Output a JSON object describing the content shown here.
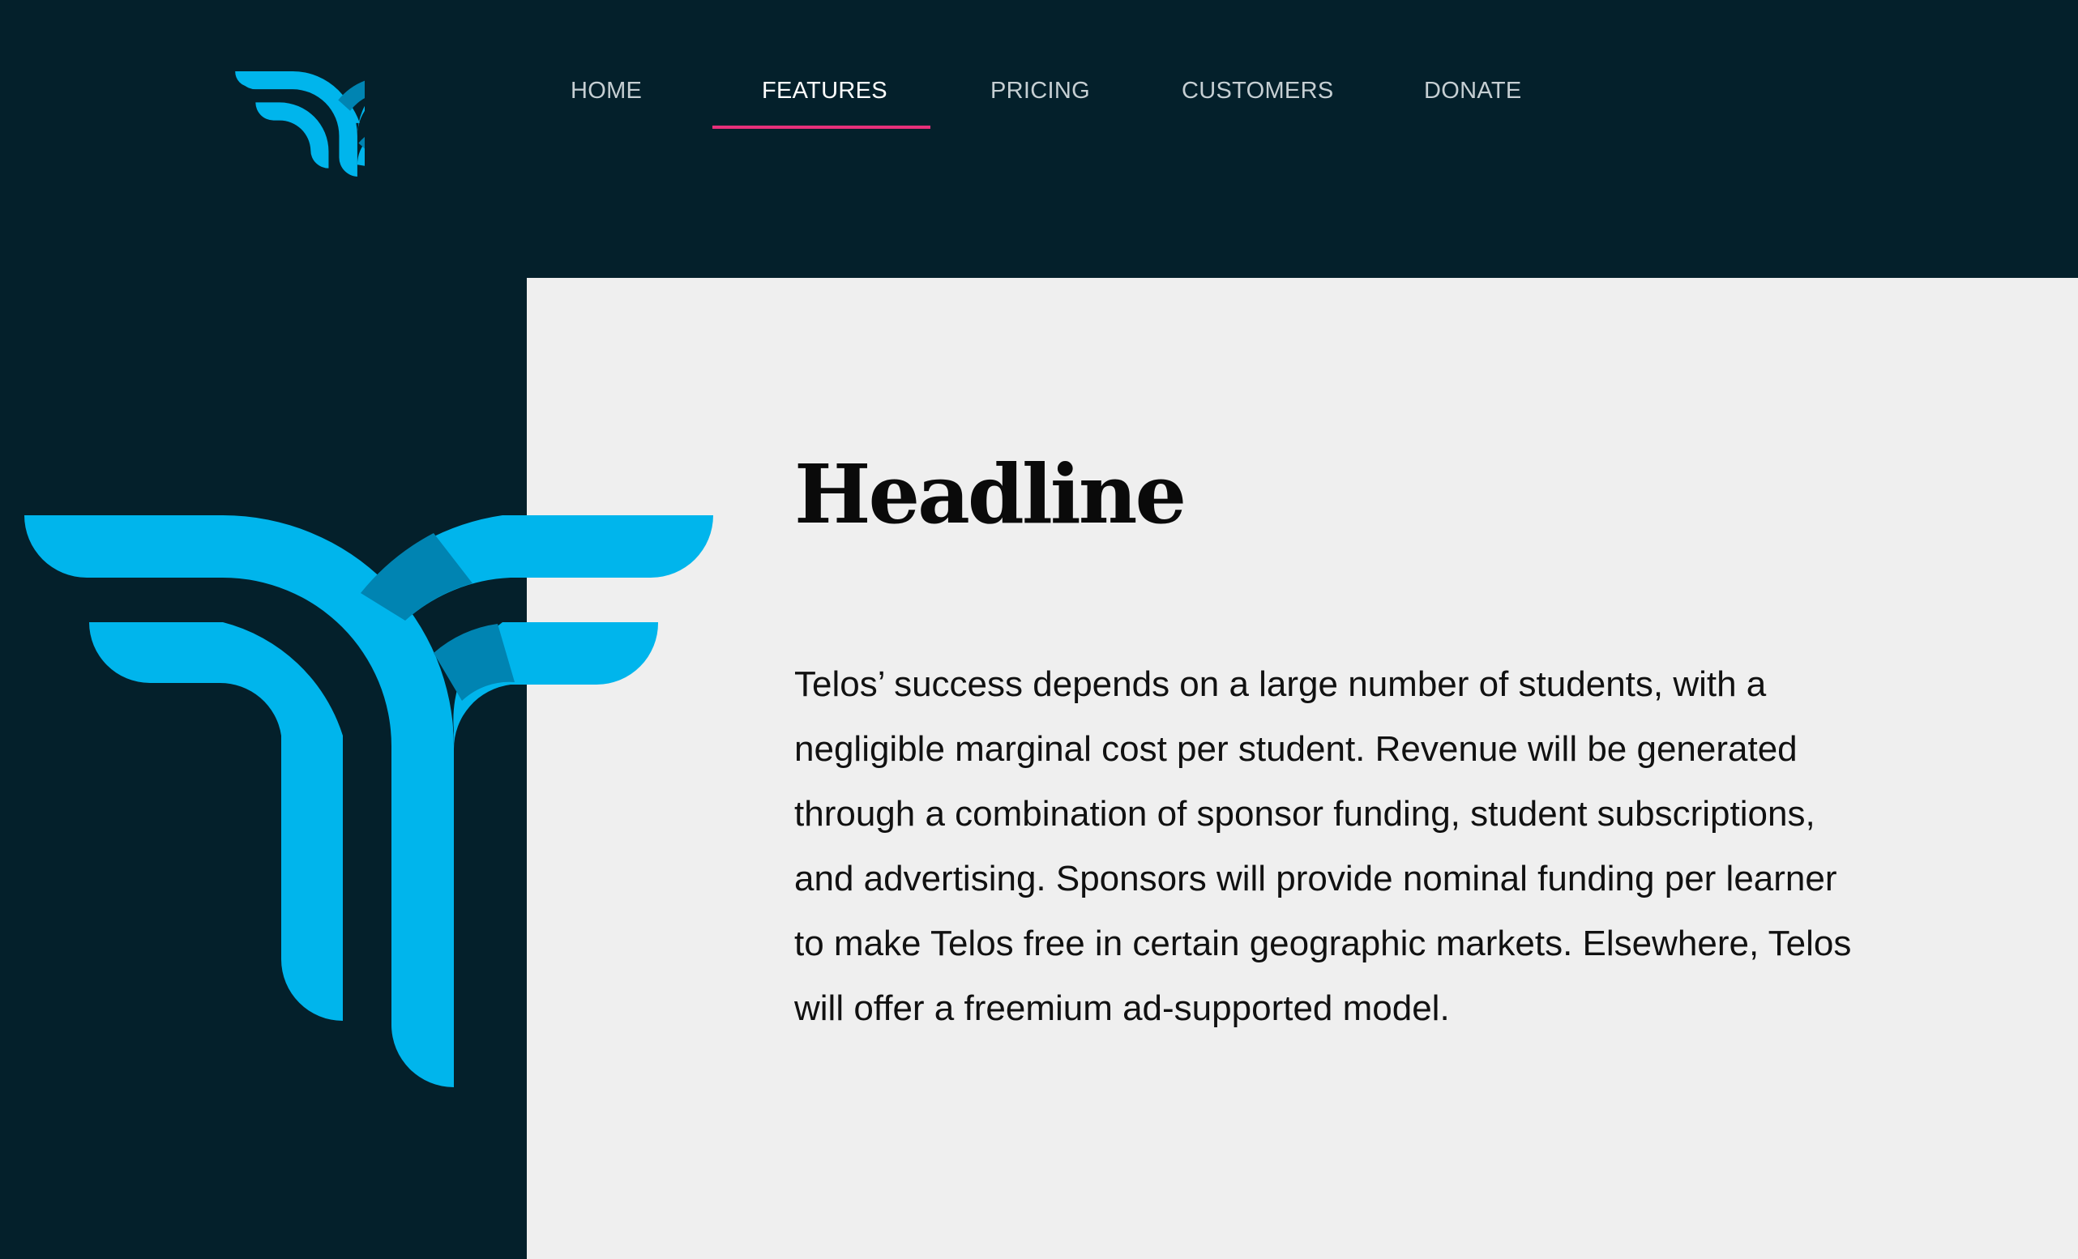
{
  "nav": {
    "items": [
      {
        "label": "HOME"
      },
      {
        "label": "FEATURES"
      },
      {
        "label": "PRICING"
      },
      {
        "label": "CUSTOMERS"
      },
      {
        "label": "DONATE"
      }
    ],
    "active": "FEATURES"
  },
  "logo": {
    "icon": "telos-t-logo-icon"
  },
  "content": {
    "headline": "Headline",
    "body": "Telos’ success depends on a large number of students, with a negligible marginal cost per student. Revenue will be generated through a combination of sponsor funding, student subscriptions, and advertising. Sponsors will provide nominal funding per learner to make Telos free in certain geographic markets. Elsewhere, Telos will offer a freemium ad-supported model."
  },
  "colors": {
    "background_dark": "#04202b",
    "panel_light": "#efefef",
    "brand_blue": "#00b5ec",
    "brand_blue_dark": "#0084b2",
    "active_underline": "#e8307a"
  }
}
